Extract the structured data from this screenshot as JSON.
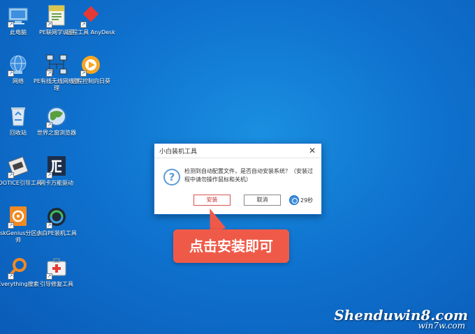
{
  "desktop": {
    "icons": [
      {
        "label": "此电脑"
      },
      {
        "label": "PE联网学说明"
      },
      {
        "label": "远程工具 AnyDesk"
      },
      {
        "label": "网络"
      },
      {
        "label": "PE有线无线网络管理"
      },
      {
        "label": "远程控制向日葵"
      },
      {
        "label": "回收站"
      },
      {
        "label": "世界之窗浏览器"
      },
      {
        "label": "BOOTICE引导工具"
      },
      {
        "label": "网卡万能驱动"
      },
      {
        "label": "DiskGenius分区大师"
      },
      {
        "label": "小白PE装机工具"
      },
      {
        "label": "Everything搜索"
      },
      {
        "label": "引导修复工具"
      }
    ],
    "shortcut_arrow": "↗"
  },
  "dialog": {
    "title": "小白装机工具",
    "close_glyph": "✕",
    "question_glyph": "?",
    "message": "检测到自动配置文件，是否自动安装系统？（安装过程中请勿操作鼠标和关机）",
    "install_label": "安装",
    "cancel_label": "取消",
    "countdown": "29秒"
  },
  "callout": {
    "text": "点击安装即可"
  },
  "watermark": {
    "line1": "Shenduwin8.com",
    "line2": "win7w.com"
  },
  "colors": {
    "desktop_bg": "#0f73cf",
    "dialog_border": "#1d6fcf",
    "install_border": "#d9534f",
    "callout_bg": "#ef5a48"
  }
}
